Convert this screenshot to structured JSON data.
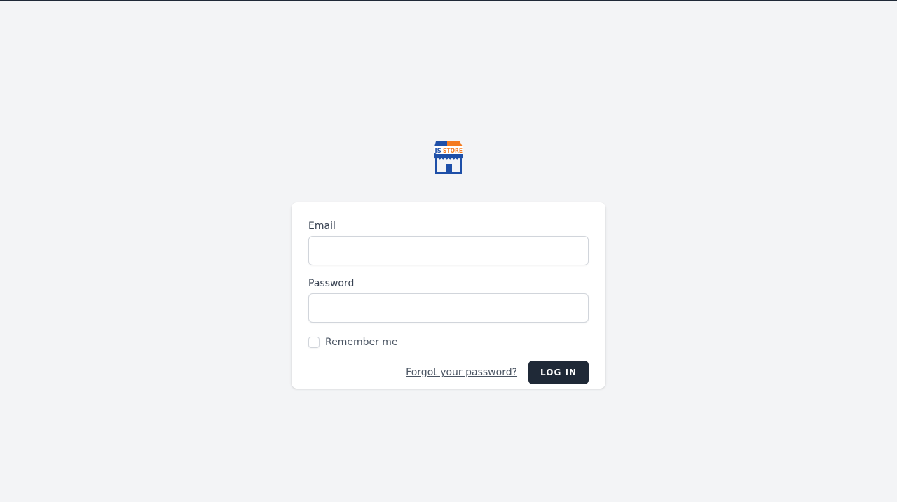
{
  "logo": {
    "brand_left": "JS",
    "brand_right": "STORE",
    "colors": {
      "blue": "#1e4fa8",
      "orange": "#f47a1f"
    }
  },
  "form": {
    "email_label": "Email",
    "email_value": "",
    "password_label": "Password",
    "password_value": "",
    "remember_label": "Remember me",
    "remember_checked": false,
    "forgot_link": "Forgot your password?",
    "login_button": "Log in"
  },
  "colors": {
    "page_background": "#f3f4f6",
    "card_background": "#ffffff",
    "button_background": "#1f2937",
    "button_text": "#ffffff"
  }
}
